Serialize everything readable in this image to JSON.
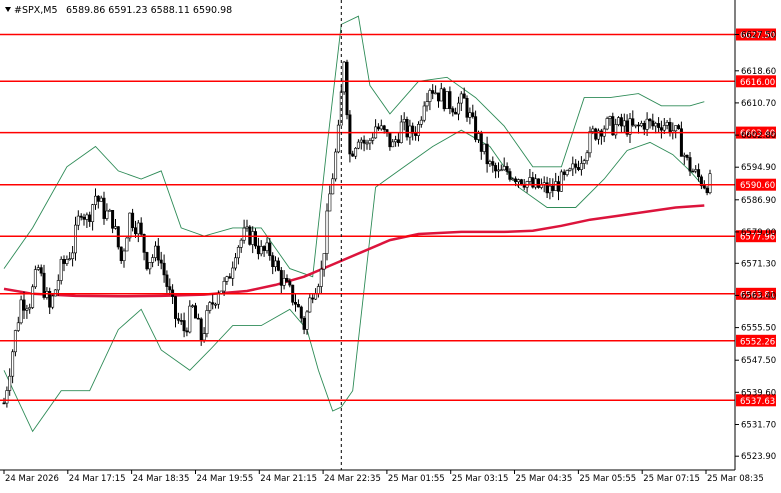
{
  "header": {
    "symbol": "#SPX,M5",
    "ohlc": "6589.86 6591.23 6588.11 6590.98"
  },
  "colors": {
    "background": "#ffffff",
    "candle": "#000000",
    "ma": "#dc143c",
    "bands": "#2e8b57",
    "level_line": "#ff0000",
    "level_label_bg": "#ff0000",
    "level_label_text": "#ffffff",
    "vline": "#000000"
  },
  "chart_data": {
    "type": "candlestick",
    "ylim": [
      6521.5,
      6635
    ],
    "y_ticks": [
      "6627.50",
      "6618.60",
      "6610.70",
      "6602.80",
      "6594.90",
      "6586.90",
      "6579.00",
      "6571.30",
      "6563.40",
      "6555.50",
      "6547.50",
      "6539.60",
      "6531.70",
      "6523.90"
    ],
    "x_ticks": [
      "24 Mar 2026",
      "24 Mar 17:15",
      "24 Mar 18:35",
      "24 Mar 19:55",
      "24 Mar 21:15",
      "24 Mar 22:35",
      "25 Mar 01:55",
      "25 Mar 03:15",
      "25 Mar 04:35",
      "25 Mar 05:55",
      "25 Mar 07:15",
      "25 Mar 08:35"
    ],
    "levels": [
      {
        "value": 6627.5,
        "label": "6627.50"
      },
      {
        "value": 6616.0,
        "label": "6616.00"
      },
      {
        "value": 6603.4,
        "label": "6603.40"
      },
      {
        "value": 6590.6,
        "label": "6590.60"
      },
      {
        "value": 6577.96,
        "label": "6577.96"
      },
      {
        "value": 6563.81,
        "label": "6563.81"
      },
      {
        "value": 6552.26,
        "label": "6552.26"
      },
      {
        "value": 6537.63,
        "label": "6537.63"
      }
    ],
    "path_points": [
      [
        0,
        6537
      ],
      [
        3,
        6550
      ],
      [
        6,
        6562
      ],
      [
        9,
        6562
      ],
      [
        12,
        6570
      ],
      [
        16,
        6560
      ],
      [
        20,
        6570
      ],
      [
        24,
        6575
      ],
      [
        27,
        6585
      ],
      [
        29,
        6582
      ],
      [
        32,
        6588
      ],
      [
        35,
        6584
      ],
      [
        38,
        6582
      ],
      [
        41,
        6572
      ],
      [
        44,
        6583
      ],
      [
        47,
        6580
      ],
      [
        50,
        6572
      ],
      [
        54,
        6574
      ],
      [
        57,
        6566
      ],
      [
        60,
        6558
      ],
      [
        63,
        6555
      ],
      [
        66,
        6560
      ],
      [
        69,
        6553
      ],
      [
        72,
        6560
      ],
      [
        75,
        6565
      ],
      [
        78,
        6566
      ],
      [
        81,
        6575
      ],
      [
        84,
        6578
      ],
      [
        87,
        6578
      ],
      [
        90,
        6574
      ],
      [
        93,
        6574
      ],
      [
        96,
        6569
      ],
      [
        99,
        6565
      ],
      [
        102,
        6562
      ],
      [
        105,
        6556
      ],
      [
        108,
        6565
      ],
      [
        111,
        6569
      ],
      [
        114,
        6588
      ],
      [
        117,
        6603
      ],
      [
        119,
        6622
      ],
      [
        121,
        6598
      ],
      [
        124,
        6603
      ],
      [
        127,
        6600
      ],
      [
        130,
        6605
      ],
      [
        133,
        6603
      ],
      [
        136,
        6600
      ],
      [
        139,
        6605
      ],
      [
        142,
        6603
      ],
      [
        145,
        6605
      ],
      [
        147,
        6612
      ],
      [
        149,
        6615
      ],
      [
        152,
        6613
      ],
      [
        155,
        6611
      ],
      [
        158,
        6610
      ],
      [
        161,
        6611
      ],
      [
        164,
        6605
      ],
      [
        167,
        6600
      ],
      [
        170,
        6595
      ],
      [
        173,
        6593
      ],
      [
        176,
        6594
      ],
      [
        179,
        6593
      ],
      [
        182,
        6592
      ],
      [
        185,
        6590
      ],
      [
        188,
        6590
      ],
      [
        191,
        6589
      ],
      [
        194,
        6591
      ],
      [
        197,
        6592
      ],
      [
        200,
        6595
      ],
      [
        203,
        6599
      ],
      [
        206,
        6603
      ],
      [
        209,
        6605
      ],
      [
        212,
        6605
      ],
      [
        215,
        6605
      ],
      [
        218,
        6605
      ],
      [
        221,
        6604
      ],
      [
        224,
        6606
      ],
      [
        227,
        6605
      ],
      [
        230,
        6606
      ],
      [
        233,
        6605
      ],
      [
        236,
        6602
      ],
      [
        239,
        6596
      ],
      [
        242,
        6593
      ],
      [
        245,
        6591
      ],
      [
        247,
        6591
      ]
    ],
    "n_candles": 248,
    "ma_points": [
      [
        0,
        6565
      ],
      [
        10,
        6563.8
      ],
      [
        25,
        6563.3
      ],
      [
        40,
        6563.2
      ],
      [
        55,
        6563.3
      ],
      [
        70,
        6563.6
      ],
      [
        85,
        6564.5
      ],
      [
        95,
        6566
      ],
      [
        105,
        6568
      ],
      [
        115,
        6571
      ],
      [
        125,
        6574
      ],
      [
        135,
        6577
      ],
      [
        145,
        6578.5
      ],
      [
        160,
        6579
      ],
      [
        175,
        6579
      ],
      [
        185,
        6579.3
      ],
      [
        195,
        6580.5
      ],
      [
        205,
        6582
      ],
      [
        215,
        6583
      ],
      [
        225,
        6584
      ],
      [
        235,
        6585
      ],
      [
        245,
        6585.5
      ]
    ],
    "upper_band": [
      [
        0,
        6570
      ],
      [
        10,
        6580
      ],
      [
        22,
        6595
      ],
      [
        32,
        6600
      ],
      [
        40,
        6594
      ],
      [
        48,
        6592
      ],
      [
        55,
        6594
      ],
      [
        62,
        6580
      ],
      [
        70,
        6578
      ],
      [
        80,
        6580
      ],
      [
        90,
        6580
      ],
      [
        100,
        6570
      ],
      [
        108,
        6568
      ],
      [
        113,
        6600
      ],
      [
        118,
        6630
      ],
      [
        124,
        6632
      ],
      [
        128,
        6615
      ],
      [
        135,
        6608
      ],
      [
        145,
        6616
      ],
      [
        155,
        6617
      ],
      [
        165,
        6612
      ],
      [
        175,
        6605
      ],
      [
        185,
        6595
      ],
      [
        195,
        6595
      ],
      [
        203,
        6612
      ],
      [
        212,
        6612
      ],
      [
        222,
        6613
      ],
      [
        230,
        6610
      ],
      [
        240,
        6610
      ],
      [
        245,
        6611
      ]
    ],
    "lower_band": [
      [
        0,
        6545
      ],
      [
        10,
        6530
      ],
      [
        20,
        6540
      ],
      [
        30,
        6540
      ],
      [
        40,
        6555
      ],
      [
        48,
        6560
      ],
      [
        55,
        6550
      ],
      [
        65,
        6545
      ],
      [
        72,
        6550
      ],
      [
        80,
        6556
      ],
      [
        90,
        6556
      ],
      [
        100,
        6560
      ],
      [
        106,
        6555
      ],
      [
        110,
        6545
      ],
      [
        115,
        6535
      ],
      [
        118,
        6536
      ],
      [
        122,
        6540
      ],
      [
        130,
        6590
      ],
      [
        140,
        6595
      ],
      [
        150,
        6600
      ],
      [
        160,
        6604
      ],
      [
        170,
        6600
      ],
      [
        180,
        6590
      ],
      [
        190,
        6585
      ],
      [
        200,
        6585
      ],
      [
        210,
        6592
      ],
      [
        218,
        6599
      ],
      [
        226,
        6601
      ],
      [
        234,
        6598
      ],
      [
        240,
        6594
      ],
      [
        245,
        6590
      ]
    ],
    "mid_band_note": "",
    "vline_index": 118
  },
  "cursor_note": ""
}
